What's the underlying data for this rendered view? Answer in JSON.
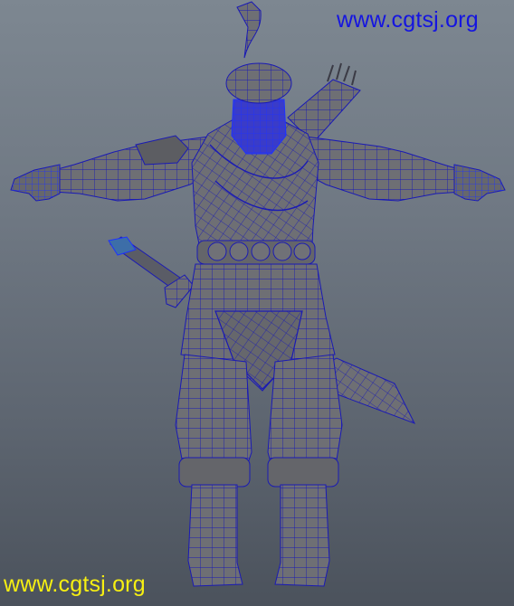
{
  "viewport": {
    "background_top": "#7d8791",
    "background_bottom": "#4b525c",
    "mesh_fill": "#6e6f74",
    "mesh_shadow": "#55565b",
    "wire_color": "#1a1ab4",
    "selected_wire_color": "#1e32ff",
    "weapon_highlight": "#3d6ea8"
  },
  "watermarks": {
    "top": {
      "text": "www.cgtsj.org",
      "color": "#1515e0"
    },
    "bottom": {
      "text": "www.cgtsj.org",
      "color": "#f6ef12"
    }
  },
  "model": {
    "icon": "wireframe-warrior-model"
  }
}
